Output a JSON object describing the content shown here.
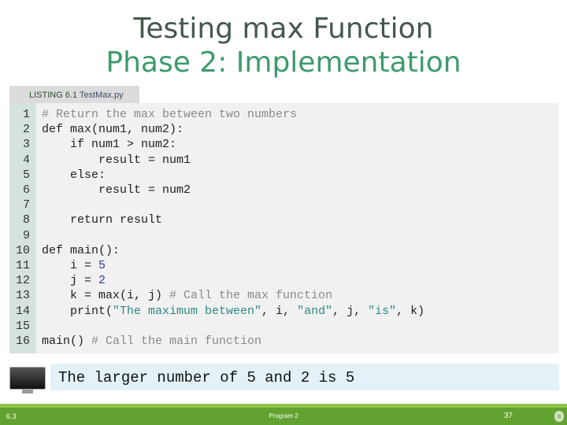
{
  "slide": {
    "title_line1": "Testing max Function",
    "title_line2": "Phase 2: Implementation",
    "title_color": "#45584d",
    "subtitle_color": "#3d9a6e"
  },
  "listing": {
    "label": "LISTING 6.1",
    "filename": "TestMax.py"
  },
  "code": {
    "lines": [
      {
        "n": "1",
        "segments": [
          {
            "t": "cm",
            "v": "# Return the max between two numbers"
          }
        ]
      },
      {
        "n": "2",
        "segments": [
          {
            "t": "tx",
            "v": "def max(num1, num2):"
          }
        ]
      },
      {
        "n": "3",
        "segments": [
          {
            "t": "tx",
            "v": "    if num1 > num2:"
          }
        ]
      },
      {
        "n": "4",
        "segments": [
          {
            "t": "tx",
            "v": "        result = num1"
          }
        ]
      },
      {
        "n": "5",
        "segments": [
          {
            "t": "tx",
            "v": "    else:"
          }
        ]
      },
      {
        "n": "6",
        "segments": [
          {
            "t": "tx",
            "v": "        result = num2"
          }
        ]
      },
      {
        "n": "7",
        "segments": []
      },
      {
        "n": "8",
        "segments": [
          {
            "t": "tx",
            "v": "    return result"
          }
        ]
      },
      {
        "n": "9",
        "segments": []
      },
      {
        "n": "10",
        "segments": [
          {
            "t": "tx",
            "v": "def main():"
          }
        ]
      },
      {
        "n": "11",
        "segments": [
          {
            "t": "tx",
            "v": "    i = "
          },
          {
            "t": "nm",
            "v": "5"
          }
        ]
      },
      {
        "n": "12",
        "segments": [
          {
            "t": "tx",
            "v": "    j = "
          },
          {
            "t": "nm",
            "v": "2"
          }
        ]
      },
      {
        "n": "13",
        "segments": [
          {
            "t": "tx",
            "v": "    k = max(i, j) "
          },
          {
            "t": "cm",
            "v": "# Call the max function"
          }
        ]
      },
      {
        "n": "14",
        "segments": [
          {
            "t": "tx",
            "v": "    print("
          },
          {
            "t": "st",
            "v": "\"The maximum between\""
          },
          {
            "t": "tx",
            "v": ", i, "
          },
          {
            "t": "st",
            "v": "\"and\""
          },
          {
            "t": "tx",
            "v": ", j, "
          },
          {
            "t": "st",
            "v": "\"is\""
          },
          {
            "t": "tx",
            "v": ", k)"
          }
        ]
      },
      {
        "n": "15",
        "segments": []
      },
      {
        "n": "16",
        "segments": [
          {
            "t": "tx",
            "v": "main() "
          },
          {
            "t": "cm",
            "v": "# Call the main function"
          }
        ]
      }
    ]
  },
  "output": {
    "icon": "monitor-icon",
    "text": "The larger number of 5 and 2 is 5"
  },
  "footer": {
    "section": "6.3",
    "center": "Program 2",
    "page": "37",
    "icon": "menu-icon"
  }
}
